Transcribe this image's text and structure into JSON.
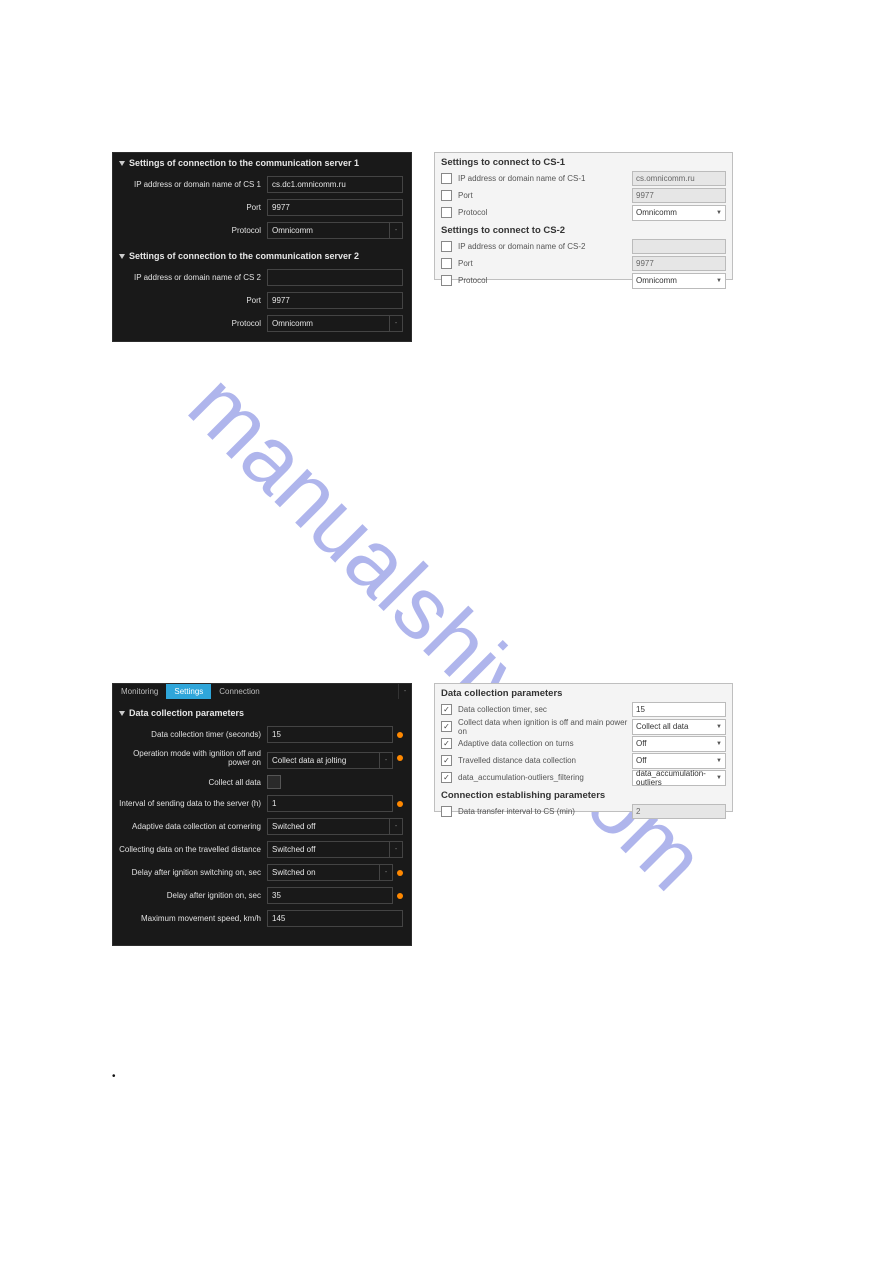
{
  "watermark": "manualshive.com",
  "dark_connection": {
    "section1_title": "Settings of connection to the communication server 1",
    "section2_title": "Settings of connection to the communication server 2",
    "rows1": {
      "ip_label": "IP address or domain name of CS 1",
      "ip_value": "cs.dc1.omnicomm.ru",
      "port_label": "Port",
      "port_value": "9977",
      "protocol_label": "Protocol",
      "protocol_value": "Omnicomm"
    },
    "rows2": {
      "ip_label": "IP address or domain name of CS 2",
      "ip_value": "",
      "port_label": "Port",
      "port_value": "9977",
      "protocol_label": "Protocol",
      "protocol_value": "Omnicomm"
    }
  },
  "light_connection": {
    "head1": "Settings to connect to CS-1",
    "head2": "Settings to connect to CS-2",
    "ip_label": "IP address or domain name of CS-1",
    "ip_value1": "cs.omnicomm.ru",
    "port_label": "Port",
    "port_value1": "9977",
    "protocol_label": "Protocol",
    "protocol_value1": "Omnicomm",
    "ip_label2": "IP address or domain name of CS-2",
    "ip_value2": "",
    "port_value2": "9977",
    "protocol_value2": "Omnicomm"
  },
  "dark_data": {
    "tab_monitoring": "Monitoring",
    "tab_settings": "Settings",
    "tab_connection": "Connection",
    "section_title": "Data collection parameters",
    "rows": {
      "timer_label": "Data collection timer (seconds)",
      "timer_value": "15",
      "opmode_label": "Operation mode with ignition off and power on",
      "opmode_value": "Collect data at jolting",
      "collect_all_label": "Collect all data",
      "interval_label": "Interval of sending data to the server (h)",
      "interval_value": "1",
      "adaptive_label": "Adaptive data collection at cornering",
      "adaptive_value": "Switched off",
      "travel_label": "Collecting data on the travelled distance",
      "travel_value": "Switched off",
      "delay_on_label": "Delay after ignition switching on, sec",
      "delay_on_value": "Switched on",
      "delay_label": "Delay after ignition on, sec",
      "delay_value": "35",
      "maxspeed_label": "Maximum movement speed, km/h",
      "maxspeed_value": "145"
    }
  },
  "light_data": {
    "head1": "Data collection parameters",
    "head2": "Connection establishing parameters",
    "r1_label": "Data collection timer, sec",
    "r1_value": "15",
    "r2_label": "Collect data when ignition is off and main power on",
    "r2_value": "Collect all data",
    "r3_label": "Adaptive data collection on turns",
    "r3_value": "Off",
    "r4_label": "Travelled distance data collection",
    "r4_value": "Off",
    "r5_label": "data_accumulation-outliers_filtering",
    "r5_value": "data_accumulation-outliers",
    "r6_label": "Data transfer interval to CS (min)",
    "r6_value": "2"
  },
  "bullet": "•"
}
